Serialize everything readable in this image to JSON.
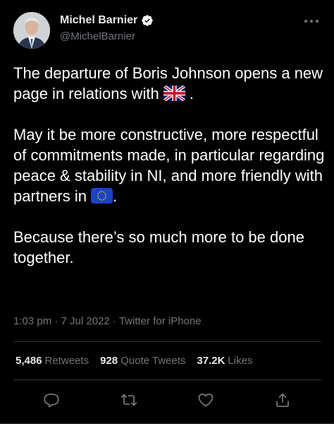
{
  "author": {
    "name": "Michel Barnier",
    "handle": "@MichelBarnier",
    "verified": true
  },
  "tweet": {
    "line1": "The departure of Boris Johnson opens a new page in relations with",
    "line1_flag": "uk-flag-icon",
    "line1_end": " .",
    "para2": "May it be more constructive, more respectful of commitments made, in particular regarding peace & stability in NI, and more friendly with partners in",
    "para2_flag": "eu-flag-icon",
    "para2_end": ".",
    "para3": "Because there’s so much more to be done together."
  },
  "meta": {
    "time": "1:03 pm",
    "date": "7 Jul 2022",
    "source": "Twitter for iPhone",
    "separator": " · "
  },
  "stats": {
    "retweets_count": "5,486",
    "retweets_label": "Retweets",
    "quotes_count": "928",
    "quotes_label": "Quote Tweets",
    "likes_count": "37.2K",
    "likes_label": "Likes"
  },
  "actions": [
    "reply-icon",
    "retweet-icon",
    "like-icon",
    "share-icon"
  ],
  "colors": {
    "background": "#000000",
    "text": "#e7e9ea",
    "secondary": "#71767b",
    "divider": "#2f3336",
    "verified_badge": "#ffffff"
  }
}
